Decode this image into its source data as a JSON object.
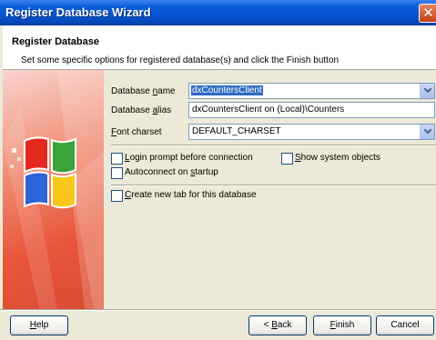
{
  "window": {
    "title": "Register Database Wizard"
  },
  "header": {
    "title": "Register Database",
    "subtitle": "Set some specific options for registered database(s) and click the Finish button"
  },
  "form": {
    "database_name": {
      "label_pre": "Database ",
      "label_key": "n",
      "label_post": "ame",
      "value": "dxCountersClient"
    },
    "database_alias": {
      "label_pre": "Database ",
      "label_key": "a",
      "label_post": "lias",
      "value": "dxCountersClient on (Local)\\Counters"
    },
    "font_charset": {
      "label_pre": "",
      "label_key": "F",
      "label_post": "ont charset",
      "value": "DEFAULT_CHARSET"
    }
  },
  "options": {
    "login_prompt": {
      "label_pre": "",
      "label_key": "L",
      "label_post": "ogin prompt before connection",
      "checked": false
    },
    "show_system_objects": {
      "label_pre": "",
      "label_key": "S",
      "label_post": "how system objects",
      "checked": false
    },
    "autoconnect": {
      "label_pre": "Autoconnect on ",
      "label_key": "s",
      "label_post": "tartup",
      "checked": false
    },
    "create_tab": {
      "label_pre": "",
      "label_key": "C",
      "label_post": "reate new tab for this database",
      "checked": false
    }
  },
  "buttons": {
    "help": {
      "pre": "",
      "key": "H",
      "post": "elp"
    },
    "back": {
      "pre": "< ",
      "key": "B",
      "post": "ack"
    },
    "finish": {
      "pre": "",
      "key": "F",
      "post": "inish"
    },
    "cancel": {
      "label": "Cancel"
    }
  }
}
